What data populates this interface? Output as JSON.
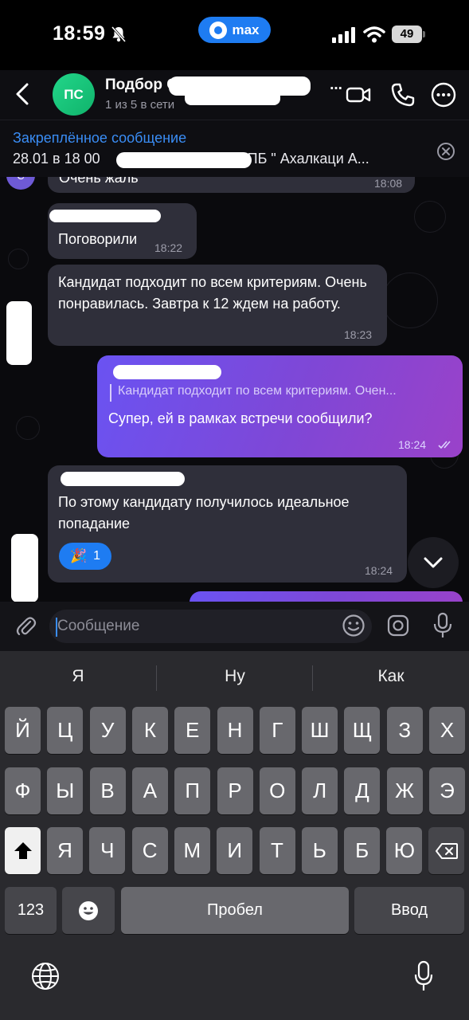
{
  "status_bar": {
    "time": "18:59",
    "app_pill": "max",
    "battery": "49"
  },
  "header": {
    "avatar_initials": "ПС",
    "title": "Подбор О",
    "title_suffix": "...",
    "subtitle": "1 из 5 в сети"
  },
  "pinned": {
    "title": "Закреплённое сообщение",
    "text_start": "28.01 в 18 00",
    "text_end": "СПБ \" Ахалкаци А..."
  },
  "messages": [
    {
      "text": "Очень жаль",
      "time": "18:08",
      "avatar": "С"
    },
    {
      "text": "Поговорили",
      "time": "18:22"
    },
    {
      "text": "Кандидат подходит по всем критериям. Очень понравилась. Завтра к 12 ждем на работу.",
      "time": "18:23"
    },
    {
      "reply": "Кандидат подходит по всем критериям. Очен...",
      "text": "Супер, ей в рамках встречи сообщили?",
      "time": "18:24"
    },
    {
      "text": "По этому кандидату получилось идеальное попадание",
      "time": "18:24",
      "reaction_count": "1",
      "reaction_emoji": "🎉"
    }
  ],
  "composer": {
    "placeholder": "Сообщение"
  },
  "keyboard": {
    "suggestions": [
      "Я",
      "Ну",
      "Как"
    ],
    "row1": [
      "Й",
      "Ц",
      "У",
      "К",
      "Е",
      "Н",
      "Г",
      "Ш",
      "Щ",
      "З",
      "Х"
    ],
    "row2": [
      "Ф",
      "Ы",
      "В",
      "А",
      "П",
      "Р",
      "О",
      "Л",
      "Д",
      "Ж",
      "Э"
    ],
    "row3": [
      "Я",
      "Ч",
      "С",
      "М",
      "И",
      "Т",
      "Ь",
      "Б",
      "Ю"
    ],
    "numbers_label": "123",
    "space_label": "Пробел",
    "enter_label": "Ввод"
  },
  "colors": {
    "accent": "#1e7cf2",
    "pinned_title": "#3a8df5",
    "incoming_bubble": "#2f2f3a",
    "outgoing_gradient": [
      "#6a53f2",
      "#9a42c9"
    ],
    "avatar_green": "#22d68a"
  }
}
